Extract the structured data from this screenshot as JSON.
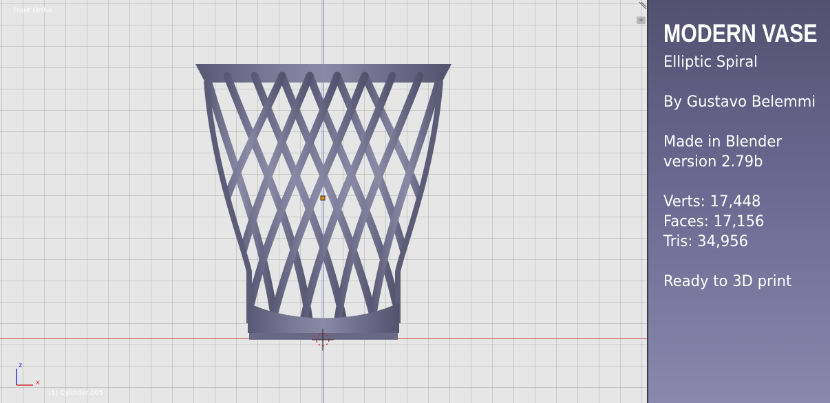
{
  "viewport": {
    "view_label": "Front Ortho",
    "object_label": "(1) Cylinder.005",
    "mini_axes": {
      "z": "z",
      "x": "x"
    },
    "colors": {
      "mesh": "#6e6d8c",
      "x_axis": "#d46a6a",
      "z_axis": "#6a6ad6",
      "origin": "#e08a00"
    },
    "plus_button": "+"
  },
  "panel": {
    "title": "MODERN VASE",
    "subtitle": "Elliptic Spiral",
    "author": "By Gustavo Belemmi",
    "made_in": "Made in Blender",
    "version": "version 2.79b",
    "verts": "Verts: 17,448",
    "faces": "Faces: 17,156",
    "tris": "Tris: 34,956",
    "ready": "Ready to 3D print"
  }
}
